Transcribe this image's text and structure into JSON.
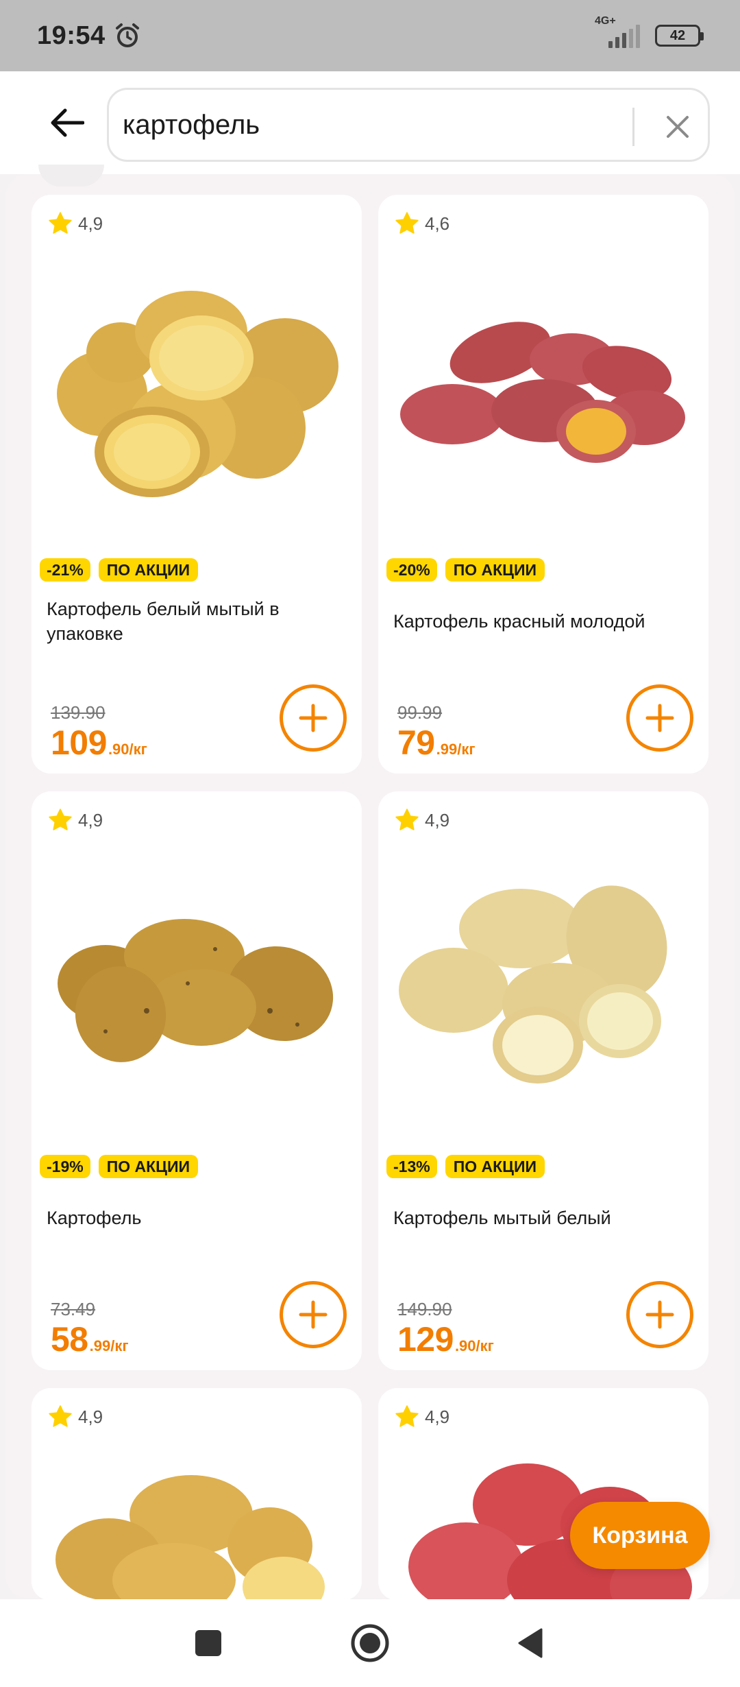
{
  "status_bar": {
    "time": "19:54",
    "network": "4G+",
    "battery": "42"
  },
  "search": {
    "value": "картофель",
    "placeholder": ""
  },
  "products": [
    {
      "rating": "4,9",
      "discount": "-21%",
      "promo": "ПО АКЦИИ",
      "title": "Картофель белый мытый в упаковке",
      "old_price": "139.90",
      "price_main": "109",
      "price_frac": ".90/кг"
    },
    {
      "rating": "4,6",
      "discount": "-20%",
      "promo": "ПО АКЦИИ",
      "title": "Картофель красный молодой",
      "old_price": "99.99",
      "price_main": "79",
      "price_frac": ".99/кг"
    },
    {
      "rating": "4,9",
      "discount": "-19%",
      "promo": "ПО АКЦИИ",
      "title": "Картофель",
      "old_price": "73.49",
      "price_main": "58",
      "price_frac": ".99/кг"
    },
    {
      "rating": "4,9",
      "discount": "-13%",
      "promo": "ПО АКЦИИ",
      "title": "Картофель мытый белый",
      "old_price": "149.90",
      "price_main": "129",
      "price_frac": ".90/кг"
    },
    {
      "rating": "4,9"
    },
    {
      "rating": "4,9"
    }
  ],
  "cart": {
    "label": "Корзина"
  },
  "colors": {
    "accent": "#f58a00",
    "price": "#f27d00",
    "badge": "#ffd600",
    "star": "#ffd000"
  }
}
